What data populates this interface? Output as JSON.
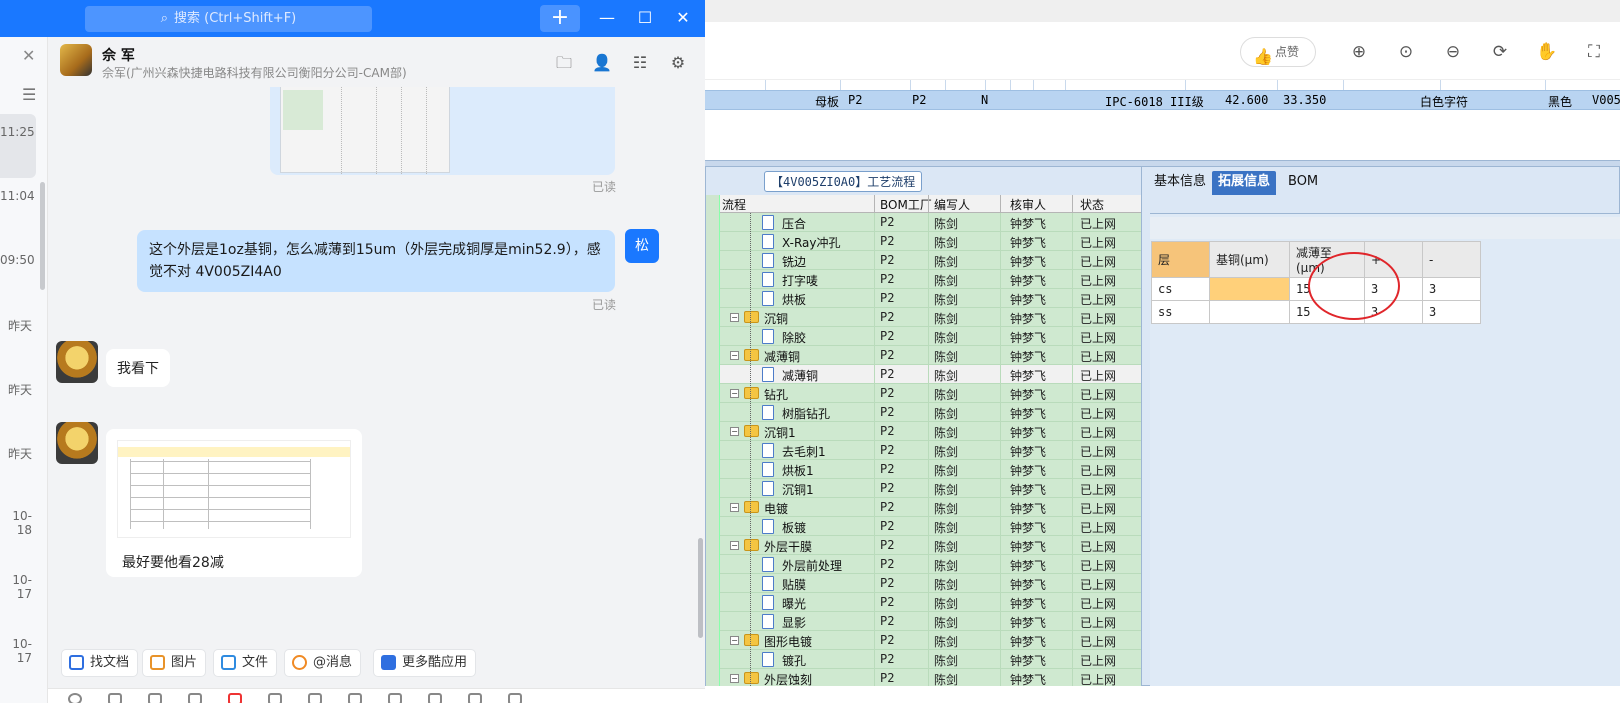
{
  "chat": {
    "search_placeholder": "搜索 (Ctrl+Shift+F)",
    "add_label": "+",
    "win_min": "—",
    "win_max": "☐",
    "win_close": "✕",
    "sessions": {
      "close": "✕",
      "times": [
        "11:25",
        "11:04",
        "09:50",
        "昨天",
        "昨天",
        "昨天",
        "10-18",
        "10-17",
        "10-17"
      ]
    },
    "contact": {
      "name": "佘 军",
      "subtitle": "佘军(广州兴森快捷电路科技有限公司衡阳分公司-CAM部)"
    },
    "messages": {
      "read_1": "已读",
      "outgoing_text": "这个外层是1oz基铜，怎么减薄到15um（外层完成铜厚是min52.9），感觉不对  4V005ZI4A0",
      "read_2": "已读",
      "my_avatar": "松",
      "incoming_1": "我看下",
      "incoming_card_caption": "最好要他看28减"
    },
    "toolbar": [
      "找文档",
      "图片",
      "文件",
      "@消息",
      "更多酷应用"
    ]
  },
  "erp": {
    "like_label": "点赞",
    "selected_row": {
      "cells": [
        "母板",
        "P2",
        "P2",
        "N",
        "IPC-6018 III级",
        "42.600",
        "33.350",
        "白色字符",
        "黑色",
        "V005"
      ]
    },
    "process": {
      "title": "【4V005ZI0A0】工艺流程",
      "headers": [
        "流程",
        "BOM工厂",
        "编写人",
        "核审人",
        "状态"
      ],
      "rows": [
        {
          "name": "压合",
          "type": "doc",
          "indent": 2,
          "factory": "P2",
          "writer": "陈剑",
          "reviewer": "钟梦飞",
          "status": "已上网"
        },
        {
          "name": "X-Ray冲孔",
          "type": "doc",
          "indent": 2,
          "factory": "P2",
          "writer": "陈剑",
          "reviewer": "钟梦飞",
          "status": "已上网"
        },
        {
          "name": "铣边",
          "type": "doc",
          "indent": 2,
          "factory": "P2",
          "writer": "陈剑",
          "reviewer": "钟梦飞",
          "status": "已上网"
        },
        {
          "name": "打字唛",
          "type": "doc",
          "indent": 2,
          "factory": "P2",
          "writer": "陈剑",
          "reviewer": "钟梦飞",
          "status": "已上网"
        },
        {
          "name": "烘板",
          "type": "doc",
          "indent": 2,
          "factory": "P2",
          "writer": "陈剑",
          "reviewer": "钟梦飞",
          "status": "已上网"
        },
        {
          "name": "沉铜",
          "type": "folder",
          "indent": 1,
          "factory": "P2",
          "writer": "陈剑",
          "reviewer": "钟梦飞",
          "status": "已上网"
        },
        {
          "name": "除胶",
          "type": "doc",
          "indent": 2,
          "factory": "P2",
          "writer": "陈剑",
          "reviewer": "钟梦飞",
          "status": "已上网"
        },
        {
          "name": "减薄铜",
          "type": "folder",
          "indent": 1,
          "factory": "P2",
          "writer": "陈剑",
          "reviewer": "钟梦飞",
          "status": "已上网"
        },
        {
          "name": "减薄铜",
          "type": "doc",
          "indent": 2,
          "factory": "P2",
          "writer": "陈剑",
          "reviewer": "钟梦飞",
          "status": "已上网",
          "selected": true
        },
        {
          "name": "钻孔",
          "type": "folder",
          "indent": 1,
          "factory": "P2",
          "writer": "陈剑",
          "reviewer": "钟梦飞",
          "status": "已上网"
        },
        {
          "name": "树脂钻孔",
          "type": "doc",
          "indent": 2,
          "factory": "P2",
          "writer": "陈剑",
          "reviewer": "钟梦飞",
          "status": "已上网"
        },
        {
          "name": "沉铜1",
          "type": "folder",
          "indent": 1,
          "factory": "P2",
          "writer": "陈剑",
          "reviewer": "钟梦飞",
          "status": "已上网"
        },
        {
          "name": "去毛刺1",
          "type": "doc",
          "indent": 2,
          "factory": "P2",
          "writer": "陈剑",
          "reviewer": "钟梦飞",
          "status": "已上网"
        },
        {
          "name": "烘板1",
          "type": "doc",
          "indent": 2,
          "factory": "P2",
          "writer": "陈剑",
          "reviewer": "钟梦飞",
          "status": "已上网"
        },
        {
          "name": "沉铜1",
          "type": "doc",
          "indent": 2,
          "factory": "P2",
          "writer": "陈剑",
          "reviewer": "钟梦飞",
          "status": "已上网"
        },
        {
          "name": "电镀",
          "type": "folder",
          "indent": 1,
          "factory": "P2",
          "writer": "陈剑",
          "reviewer": "钟梦飞",
          "status": "已上网"
        },
        {
          "name": "板镀",
          "type": "doc",
          "indent": 2,
          "factory": "P2",
          "writer": "陈剑",
          "reviewer": "钟梦飞",
          "status": "已上网"
        },
        {
          "name": "外层干膜",
          "type": "folder",
          "indent": 1,
          "factory": "P2",
          "writer": "陈剑",
          "reviewer": "钟梦飞",
          "status": "已上网"
        },
        {
          "name": "外层前处理",
          "type": "doc",
          "indent": 2,
          "factory": "P2",
          "writer": "陈剑",
          "reviewer": "钟梦飞",
          "status": "已上网"
        },
        {
          "name": "贴膜",
          "type": "doc",
          "indent": 2,
          "factory": "P2",
          "writer": "陈剑",
          "reviewer": "钟梦飞",
          "status": "已上网"
        },
        {
          "name": "曝光",
          "type": "doc",
          "indent": 2,
          "factory": "P2",
          "writer": "陈剑",
          "reviewer": "钟梦飞",
          "status": "已上网"
        },
        {
          "name": "显影",
          "type": "doc",
          "indent": 2,
          "factory": "P2",
          "writer": "陈剑",
          "reviewer": "钟梦飞",
          "status": "已上网"
        },
        {
          "name": "图形电镀",
          "type": "folder",
          "indent": 1,
          "factory": "P2",
          "writer": "陈剑",
          "reviewer": "钟梦飞",
          "status": "已上网"
        },
        {
          "name": "镀孔",
          "type": "doc",
          "indent": 2,
          "factory": "P2",
          "writer": "陈剑",
          "reviewer": "钟梦飞",
          "status": "已上网"
        },
        {
          "name": "外层蚀刻",
          "type": "folder",
          "indent": 1,
          "factory": "P2",
          "writer": "陈剑",
          "reviewer": "钟梦飞",
          "status": "已上网"
        }
      ]
    },
    "info": {
      "tabs": [
        "基本信息",
        "拓展信息",
        "BOM"
      ],
      "active_tab": "拓展信息",
      "table": {
        "headers": [
          "层",
          "基铜(μm)",
          "减薄至(μm)",
          "+",
          "-"
        ],
        "rows": [
          [
            "cs",
            "",
            "15",
            "3",
            "3"
          ],
          [
            "ss",
            "",
            "15",
            "3",
            "3"
          ]
        ]
      }
    }
  }
}
